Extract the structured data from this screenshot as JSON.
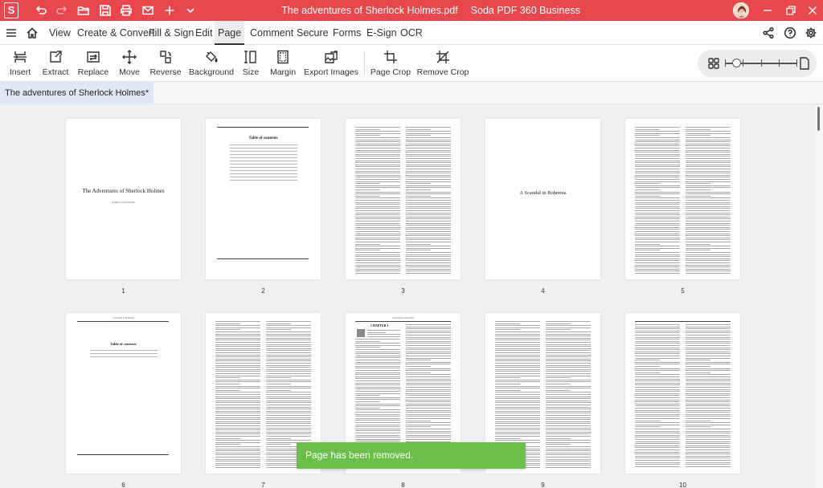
{
  "titlebar": {
    "app_icon_letter": "S",
    "file_title": "The adventures of Sherlock Holmes.pdf",
    "app_name": "Soda PDF 360 Business",
    "accent_color": "#e8474e"
  },
  "menu": {
    "tabs": [
      "View",
      "Create & Convert",
      "Fill & Sign",
      "Edit",
      "Page",
      "Comment",
      "Secure",
      "Forms",
      "E-Sign",
      "OCR"
    ],
    "active_tab": "Page"
  },
  "ribbon": {
    "tools": [
      "Insert",
      "Extract",
      "Replace",
      "Move",
      "Reverse",
      "Background",
      "Size",
      "Margin",
      "Export Images",
      "Page Crop",
      "Remove Crop"
    ]
  },
  "zoom": {
    "level_fraction": 0.16
  },
  "document_tab": {
    "label": "The adventures of Sherlock Holmes*"
  },
  "pages": {
    "numbers": [
      "1",
      "2",
      "3",
      "4",
      "5",
      "6",
      "7",
      "8",
      "9",
      "10"
    ],
    "p1_title": "The Adventures of Sherlock Holmes",
    "p1_author": "Arthur Conan Doyle",
    "p2_heading": "Table of contents",
    "p4_title": "A Scandal in Bohemia",
    "p6_header": "A Scandal in Bohemia",
    "p6_heading": "Table of contents",
    "p8_header": "A Scandal in Bohemia",
    "p8_chapter": "CHAPTER I"
  },
  "toast": {
    "message": "Page has been removed.",
    "color": "#6cbf4b"
  }
}
